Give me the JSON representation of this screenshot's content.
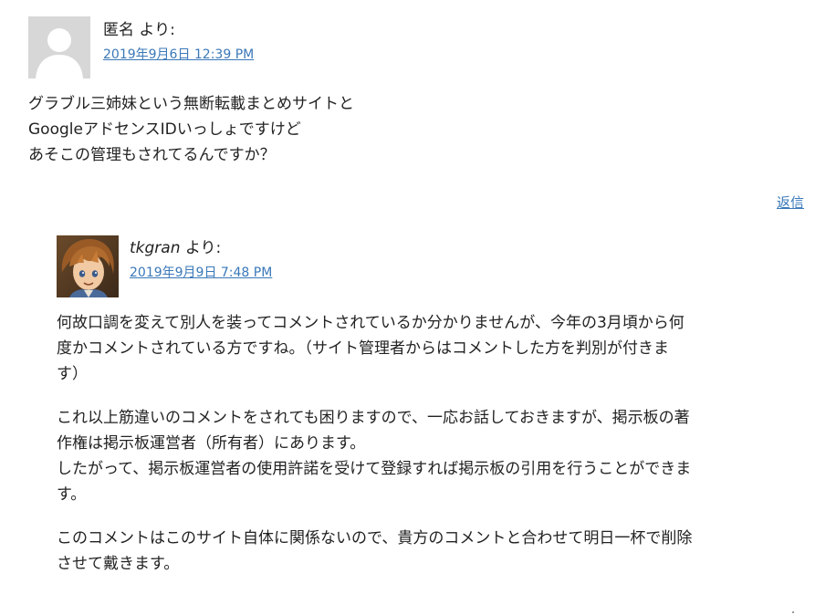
{
  "comments": [
    {
      "author": "匿名",
      "author_suffix": " より:",
      "date": "2019年9月6日 12:39 PM",
      "lines": [
        "グラブル三姉妹という無断転載まとめサイトと",
        "GoogleアドセンスIDいっしょですけど",
        "あそこの管理もされてるんですか？"
      ],
      "reply_label": "返信"
    },
    {
      "author": "tkgran",
      "author_suffix": " より:",
      "date": "2019年9月9日 7:48 PM",
      "paragraphs": [
        [
          "何故口調を変えて別人を装ってコメントされているか分かりませんが、今年の3月頃から何",
          "度かコメントされている方ですね。（サイト管理者からはコメントした方を判別が付きま",
          "す）"
        ],
        [
          "これ以上筋違いのコメントをされても困りますので、一応お話しておきますが、掲示板の著",
          "作権は掲示板運営者（所有者）にあります。",
          "したがって、掲示板運営者の使用許諾を受けて登録すれば掲示板の引用を行うことができま",
          "す。"
        ],
        [
          "このコメントはこのサイト自体に関係ないので、貴方のコメントと合わせて明日一杯で削除",
          "させて戴きます。"
        ]
      ]
    }
  ],
  "colors": {
    "link": "#3a78b8",
    "text": "#222222",
    "default_avatar_bg": "#d7d7d7",
    "default_avatar_fg": "#ffffff"
  },
  "icons": {
    "anonymous_avatar": "default-person-silhouette",
    "tkgran_avatar": "anime-character-portrait"
  }
}
